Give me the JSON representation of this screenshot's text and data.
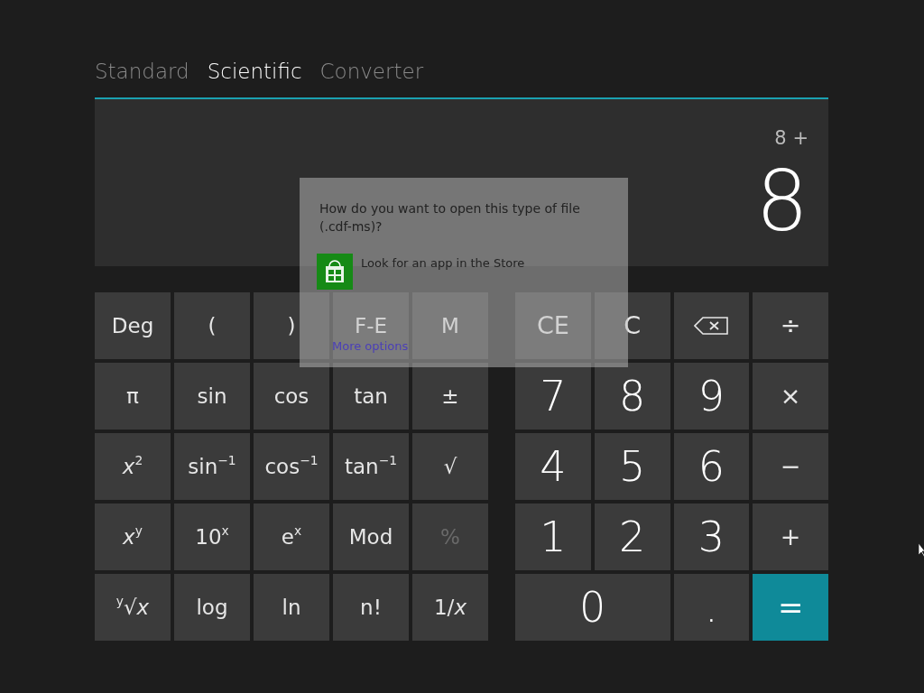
{
  "tabs": [
    {
      "label": "Standard",
      "selected": false
    },
    {
      "label": "Scientific",
      "selected": true
    },
    {
      "label": "Converter",
      "selected": false
    }
  ],
  "display": {
    "expression": "8 +",
    "value": "8"
  },
  "function_keys": [
    {
      "label": "Deg",
      "kind": "fn",
      "disabled": false
    },
    {
      "label": "(",
      "kind": "fn",
      "disabled": false
    },
    {
      "label": ")",
      "kind": "fn",
      "disabled": false
    },
    {
      "label": "F-E",
      "kind": "fn",
      "disabled": false
    },
    {
      "label": "M",
      "kind": "fn",
      "disabled": false
    },
    {
      "label": "π",
      "kind": "fn",
      "disabled": false
    },
    {
      "label": "sin",
      "kind": "fn",
      "disabled": false
    },
    {
      "label": "cos",
      "kind": "fn",
      "disabled": false
    },
    {
      "label": "tan",
      "kind": "fn",
      "disabled": false
    },
    {
      "label": "±",
      "kind": "fn",
      "disabled": false
    },
    {
      "label": "*x*$^{2}$",
      "kind": "fn",
      "disabled": false
    },
    {
      "label": "sin$^{−1}$",
      "kind": "fn",
      "disabled": false
    },
    {
      "label": "cos$^{−1}$",
      "kind": "fn",
      "disabled": false
    },
    {
      "label": "tan$^{−1}$",
      "kind": "fn",
      "disabled": false
    },
    {
      "label": "√",
      "kind": "fn",
      "disabled": false
    },
    {
      "label": "*x*$^{y}$",
      "kind": "fn",
      "disabled": false
    },
    {
      "label": "10$^{x}$",
      "kind": "fn",
      "disabled": false
    },
    {
      "label": "e$^{x}$",
      "kind": "fn",
      "disabled": false
    },
    {
      "label": "Mod",
      "kind": "fn",
      "disabled": false
    },
    {
      "label": "%",
      "kind": "fn",
      "disabled": true
    },
    {
      "label": "$^{y}$√*x*",
      "kind": "fn",
      "disabled": false
    },
    {
      "label": "log",
      "kind": "fn",
      "disabled": false
    },
    {
      "label": "ln",
      "kind": "fn",
      "disabled": false
    },
    {
      "label": "n!",
      "kind": "fn",
      "disabled": false
    },
    {
      "label": "1/*x*",
      "kind": "fn",
      "disabled": false
    }
  ],
  "number_keys": [
    {
      "label": "CE",
      "kind": "op",
      "disabled": false
    },
    {
      "label": "C",
      "kind": "op",
      "disabled": false
    },
    {
      "kind": "backspace",
      "disabled": false
    },
    {
      "label": "÷",
      "kind": "op",
      "disabled": false
    },
    {
      "label": "7",
      "kind": "digit",
      "disabled": false
    },
    {
      "label": "8",
      "kind": "digit",
      "disabled": false
    },
    {
      "label": "9",
      "kind": "digit",
      "disabled": false
    },
    {
      "label": "×",
      "kind": "op",
      "disabled": false
    },
    {
      "label": "4",
      "kind": "digit",
      "disabled": false
    },
    {
      "label": "5",
      "kind": "digit",
      "disabled": false
    },
    {
      "label": "6",
      "kind": "digit",
      "disabled": false
    },
    {
      "label": "−",
      "kind": "op",
      "disabled": false
    },
    {
      "label": "1",
      "kind": "digit",
      "disabled": false
    },
    {
      "label": "2",
      "kind": "digit",
      "disabled": false
    },
    {
      "label": "3",
      "kind": "digit",
      "disabled": false
    },
    {
      "label": "+",
      "kind": "op",
      "disabled": false
    },
    {
      "label": "0",
      "kind": "wide-digit",
      "disabled": false
    },
    {
      "label": ".",
      "kind": "digit",
      "disabled": false
    },
    {
      "label": "=",
      "kind": "accent",
      "disabled": false
    }
  ],
  "open_with_dialog": {
    "question": "How do you want to open this type of file (.cdf-ms)?",
    "store_link": "Look for an app in the Store",
    "more_options": "More options"
  }
}
